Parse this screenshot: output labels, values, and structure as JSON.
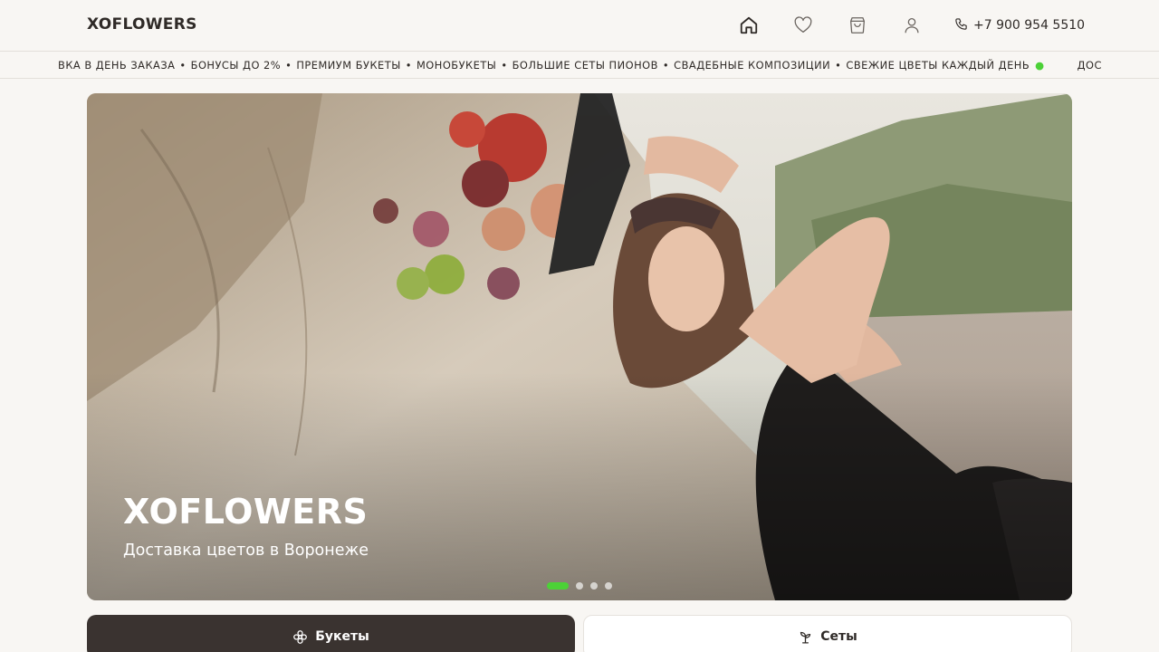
{
  "header": {
    "logo": "XOFLOWERS",
    "icons": [
      "home-icon",
      "heart-icon",
      "cart-icon",
      "user-icon"
    ],
    "phone": "+7 900 954 5510"
  },
  "ticker": {
    "items": [
      "ВКА В ДЕНЬ ЗАКАЗА",
      "БОНУСЫ ДО 2%",
      "ПРЕМИУМ БУКЕТЫ",
      "МОНОБУКЕТЫ",
      "БОЛЬШИЕ СЕТЫ ПИОНОВ",
      "СВАДЕБНЫЕ КОМПОЗИЦИИ",
      "СВЕЖИЕ ЦВЕТЫ КАЖДЫЙ ДЕНЬ"
    ],
    "separator": "•",
    "tail": "ДОСТАВКА"
  },
  "hero": {
    "title": "XOFLOWERS",
    "subtitle": "Доставка цветов в Воронеже",
    "slides": 4,
    "active_slide": 1
  },
  "tabs": [
    {
      "label": "Букеты",
      "icon": "flower-icon",
      "active": true
    },
    {
      "label": "Сеты",
      "icon": "sprout-icon",
      "active": false
    }
  ],
  "colors": {
    "background": "#f8f6f3",
    "text": "#2f2a27",
    "accent": "#4cd137",
    "dark_button": "#3a3330"
  }
}
